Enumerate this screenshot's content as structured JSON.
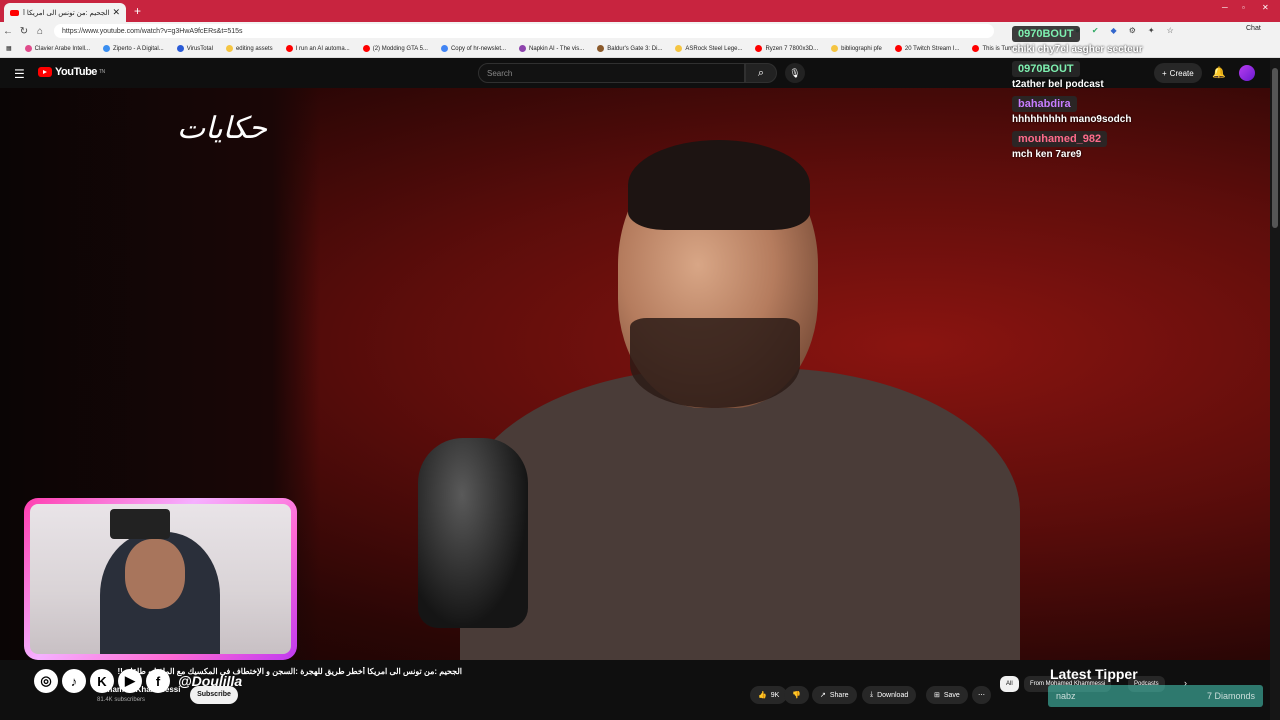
{
  "browser": {
    "tab_title": "الجحيم :من تونس الى امريكا أخطر طر",
    "url": "https://www.youtube.com/watch?v=g3HwA9fcERs&t=515s",
    "chat_label": "Chat",
    "bookmarks": [
      {
        "label": "Clavier Arabe Intell...",
        "color": "#e04b8b"
      },
      {
        "label": "Ziperto - A Digital...",
        "color": "#3a8ef0"
      },
      {
        "label": "VirusTotal",
        "color": "#2a5bd7"
      },
      {
        "label": "editing assets",
        "color": "#f5c542"
      },
      {
        "label": "I run an AI automa...",
        "color": "#ff0000"
      },
      {
        "label": "(2) Modding GTA 5...",
        "color": "#ff0000"
      },
      {
        "label": "Copy of hr-newslet...",
        "color": "#4285f4"
      },
      {
        "label": "Napkin AI - The vis...",
        "color": "#8e44ad"
      },
      {
        "label": "Baldur's Gate 3: Di...",
        "color": "#8b5a2b"
      },
      {
        "label": "ASRock Steel Lege...",
        "color": "#f5c542"
      },
      {
        "label": "Ryzen 7 7800x3D...",
        "color": "#ff0000"
      },
      {
        "label": "bibliographi pfe",
        "color": "#f5c542"
      },
      {
        "label": "20 Twitch Stream I...",
        "color": "#ff0000"
      },
      {
        "label": "This is Turn",
        "color": "#ff0000"
      }
    ]
  },
  "youtube": {
    "logo_text": "YouTube",
    "logo_sup": "TN",
    "search_placeholder": "Search",
    "create_label": "Create",
    "video_title": "الجحيم :من تونس الى امريكا أخطر طريق للهجرة :السجن و الإختطاف في المكسيك مع المافيا و طلقات!!",
    "channel": "Mohamed Khammessi",
    "subscribers": "81.4K subscribers",
    "subscribe_label": "Subscribe",
    "likes": "9K",
    "share_label": "Share",
    "download_label": "Download",
    "save_label": "Save",
    "chips": [
      "All",
      "From Mohamed Khammessi",
      "Podcasts"
    ],
    "overlay_logo_text": "حكايات"
  },
  "stream_overlay": {
    "handle": "@Doulilla",
    "latest_tipper_title": "Latest Tipper",
    "tipper_name": "nabz",
    "tipper_amount": "7 Diamonds",
    "chat": [
      {
        "user": "0970BOUT",
        "user_color": "#7ef0b0",
        "message": "chiki chy7el asgher secteur"
      },
      {
        "user": "0970BOUT",
        "user_color": "#7ef0b0",
        "message": "t2ather bel podcast"
      },
      {
        "user": "bahabdira",
        "user_color": "#c77dff",
        "message": "hhhhhhhhh mano9sodch"
      },
      {
        "user": "mouhamed_982",
        "user_color": "#ff6b8b",
        "message": "mch ken 7are9"
      }
    ]
  }
}
